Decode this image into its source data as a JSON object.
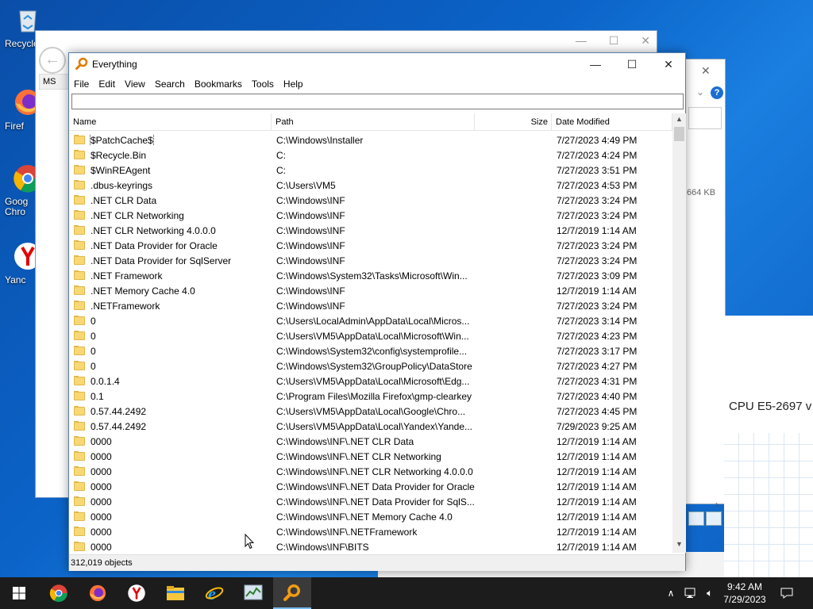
{
  "desktop": {
    "icons": [
      {
        "label": "Recycle"
      },
      {
        "label": "Firef"
      },
      {
        "label": "Goog Chro"
      },
      {
        "label": "Yanc"
      }
    ]
  },
  "background": {
    "window1_label": "MS",
    "window2_size": "664 KB",
    "window3_cpu": "CPU E5-2697 v"
  },
  "window": {
    "title": "Everything",
    "controls": {
      "minimize": "—",
      "maximize": "☐",
      "close": "✕"
    }
  },
  "menu": [
    "File",
    "Edit",
    "View",
    "Search",
    "Bookmarks",
    "Tools",
    "Help"
  ],
  "search": {
    "value": "",
    "placeholder": ""
  },
  "columns": {
    "name": "Name",
    "path": "Path",
    "size": "Size",
    "date": "Date Modified"
  },
  "rows": [
    {
      "name": "$PatchCache$",
      "path": "C:\\Windows\\Installer",
      "size": "",
      "date": "7/27/2023 4:49 PM"
    },
    {
      "name": "$Recycle.Bin",
      "path": "C:",
      "size": "",
      "date": "7/27/2023 4:24 PM"
    },
    {
      "name": "$WinREAgent",
      "path": "C:",
      "size": "",
      "date": "7/27/2023 3:51 PM"
    },
    {
      "name": ".dbus-keyrings",
      "path": "C:\\Users\\VM5",
      "size": "",
      "date": "7/27/2023 4:53 PM"
    },
    {
      "name": ".NET CLR Data",
      "path": "C:\\Windows\\INF",
      "size": "",
      "date": "7/27/2023 3:24 PM"
    },
    {
      "name": ".NET CLR Networking",
      "path": "C:\\Windows\\INF",
      "size": "",
      "date": "7/27/2023 3:24 PM"
    },
    {
      "name": ".NET CLR Networking 4.0.0.0",
      "path": "C:\\Windows\\INF",
      "size": "",
      "date": "12/7/2019 1:14 AM"
    },
    {
      "name": ".NET Data Provider for Oracle",
      "path": "C:\\Windows\\INF",
      "size": "",
      "date": "7/27/2023 3:24 PM"
    },
    {
      "name": ".NET Data Provider for SqlServer",
      "path": "C:\\Windows\\INF",
      "size": "",
      "date": "7/27/2023 3:24 PM"
    },
    {
      "name": ".NET Framework",
      "path": "C:\\Windows\\System32\\Tasks\\Microsoft\\Win...",
      "size": "",
      "date": "7/27/2023 3:09 PM"
    },
    {
      "name": ".NET Memory Cache 4.0",
      "path": "C:\\Windows\\INF",
      "size": "",
      "date": "12/7/2019 1:14 AM"
    },
    {
      "name": ".NETFramework",
      "path": "C:\\Windows\\INF",
      "size": "",
      "date": "7/27/2023 3:24 PM"
    },
    {
      "name": "0",
      "path": "C:\\Users\\LocalAdmin\\AppData\\Local\\Micros...",
      "size": "",
      "date": "7/27/2023 3:14 PM"
    },
    {
      "name": "0",
      "path": "C:\\Users\\VM5\\AppData\\Local\\Microsoft\\Win...",
      "size": "",
      "date": "7/27/2023 4:23 PM"
    },
    {
      "name": "0",
      "path": "C:\\Windows\\System32\\config\\systemprofile...",
      "size": "",
      "date": "7/27/2023 3:17 PM"
    },
    {
      "name": "0",
      "path": "C:\\Windows\\System32\\GroupPolicy\\DataStore",
      "size": "",
      "date": "7/27/2023 4:27 PM"
    },
    {
      "name": "0.0.1.4",
      "path": "C:\\Users\\VM5\\AppData\\Local\\Microsoft\\Edg...",
      "size": "",
      "date": "7/27/2023 4:31 PM"
    },
    {
      "name": "0.1",
      "path": "C:\\Program Files\\Mozilla Firefox\\gmp-clearkey",
      "size": "",
      "date": "7/27/2023 4:40 PM"
    },
    {
      "name": "0.57.44.2492",
      "path": "C:\\Users\\VM5\\AppData\\Local\\Google\\Chro...",
      "size": "",
      "date": "7/27/2023 4:45 PM"
    },
    {
      "name": "0.57.44.2492",
      "path": "C:\\Users\\VM5\\AppData\\Local\\Yandex\\Yande...",
      "size": "",
      "date": "7/29/2023 9:25 AM"
    },
    {
      "name": "0000",
      "path": "C:\\Windows\\INF\\.NET CLR Data",
      "size": "",
      "date": "12/7/2019 1:14 AM"
    },
    {
      "name": "0000",
      "path": "C:\\Windows\\INF\\.NET CLR Networking",
      "size": "",
      "date": "12/7/2019 1:14 AM"
    },
    {
      "name": "0000",
      "path": "C:\\Windows\\INF\\.NET CLR Networking 4.0.0.0",
      "size": "",
      "date": "12/7/2019 1:14 AM"
    },
    {
      "name": "0000",
      "path": "C:\\Windows\\INF\\.NET Data Provider for Oracle",
      "size": "",
      "date": "12/7/2019 1:14 AM"
    },
    {
      "name": "0000",
      "path": "C:\\Windows\\INF\\.NET Data Provider for SqlS...",
      "size": "",
      "date": "12/7/2019 1:14 AM"
    },
    {
      "name": "0000",
      "path": "C:\\Windows\\INF\\.NET Memory Cache 4.0",
      "size": "",
      "date": "12/7/2019 1:14 AM"
    },
    {
      "name": "0000",
      "path": "C:\\Windows\\INF\\.NETFramework",
      "size": "",
      "date": "12/7/2019 1:14 AM"
    },
    {
      "name": "0000",
      "path": "C:\\Windows\\INF\\BITS",
      "size": "",
      "date": "12/7/2019 1:14 AM"
    }
  ],
  "status": {
    "text": "312,019 objects"
  },
  "taskbar": {
    "apps": [
      "start-icon",
      "chrome-icon",
      "firefox-icon",
      "yandex-icon",
      "file-explorer-icon",
      "internet-explorer-icon",
      "task-manager-icon",
      "everything-icon"
    ],
    "clock_time": "9:42 AM",
    "clock_date": "7/29/2023"
  },
  "colors": {
    "accent": "#0078d7",
    "taskbar": "#1c1c1c",
    "folder": "#f8d775"
  }
}
